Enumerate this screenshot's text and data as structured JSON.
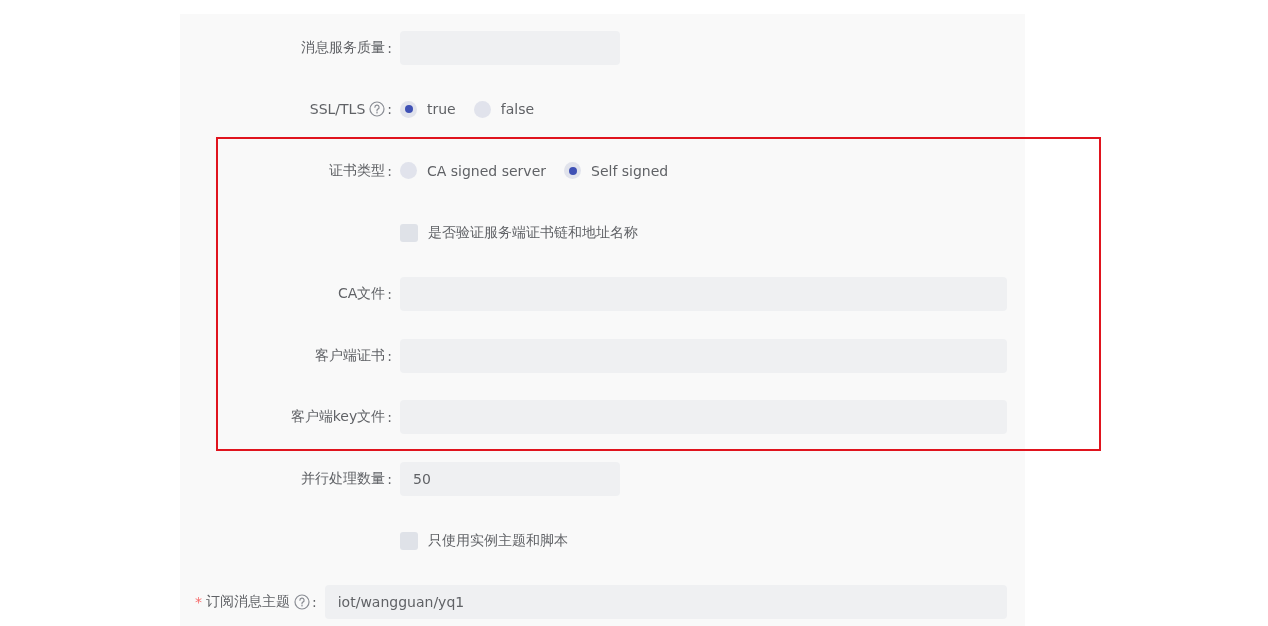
{
  "groups": [
    {
      "highlighted": false,
      "fields": [
        {
          "kind": "short_input",
          "label": "消息服务质量",
          "colon": ":"
        },
        {
          "kind": "radio",
          "label": "SSL/TLS",
          "help": true,
          "colon": ":",
          "options": [
            {
              "label": "true",
              "selected": true
            },
            {
              "label": "false",
              "selected": false
            }
          ]
        }
      ]
    },
    {
      "highlighted": true,
      "fields": [
        {
          "kind": "radio",
          "label": "证书类型",
          "colon": ":",
          "options": [
            {
              "label": "CA signed server",
              "selected": false
            },
            {
              "label": "Self signed",
              "selected": true
            }
          ]
        },
        {
          "kind": "checkbox",
          "label": "是否验证服务端证书链和地址名称",
          "checked": false
        },
        {
          "kind": "input",
          "label": "CA文件",
          "colon": ":"
        },
        {
          "kind": "input",
          "label": "客户端证书",
          "colon": ":"
        },
        {
          "kind": "input",
          "label": "客户端key文件",
          "colon": ":"
        }
      ]
    },
    {
      "highlighted": false,
      "fields": [
        {
          "kind": "short_input",
          "label": "并行处理数量",
          "colon": ":",
          "value": "50"
        },
        {
          "kind": "checkbox",
          "label": "只使用实例主题和脚本",
          "checked": false
        },
        {
          "kind": "input",
          "label": "订阅消息主题",
          "required_mark": "*",
          "help": true,
          "colon": ":",
          "value": "iot/wangguan/yq1"
        }
      ]
    }
  ]
}
